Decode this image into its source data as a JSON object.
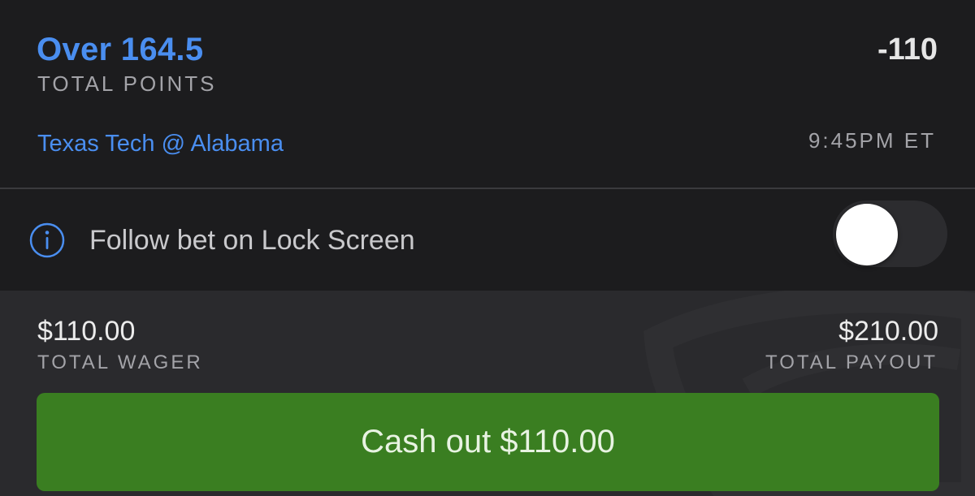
{
  "bet": {
    "selection": "Over 164.5",
    "odds": "-110",
    "market": "TOTAL POINTS",
    "matchup": "Texas Tech @ Alabama",
    "time": "9:45PM ET"
  },
  "lock_screen": {
    "icon": "info-icon",
    "label": "Follow bet on Lock Screen",
    "toggle_on": false
  },
  "summary": {
    "wager_amount": "$110.00",
    "wager_label": "TOTAL WAGER",
    "payout_amount": "$210.00",
    "payout_label": "TOTAL PAYOUT"
  },
  "cashout": {
    "label": "Cash out $110.00"
  },
  "colors": {
    "background": "#1c1c1e",
    "summary_background": "#2a2a2d",
    "accent_blue": "#4a8ef0",
    "cashout_green": "#3a7e21",
    "muted_text": "#a3a3a8"
  }
}
